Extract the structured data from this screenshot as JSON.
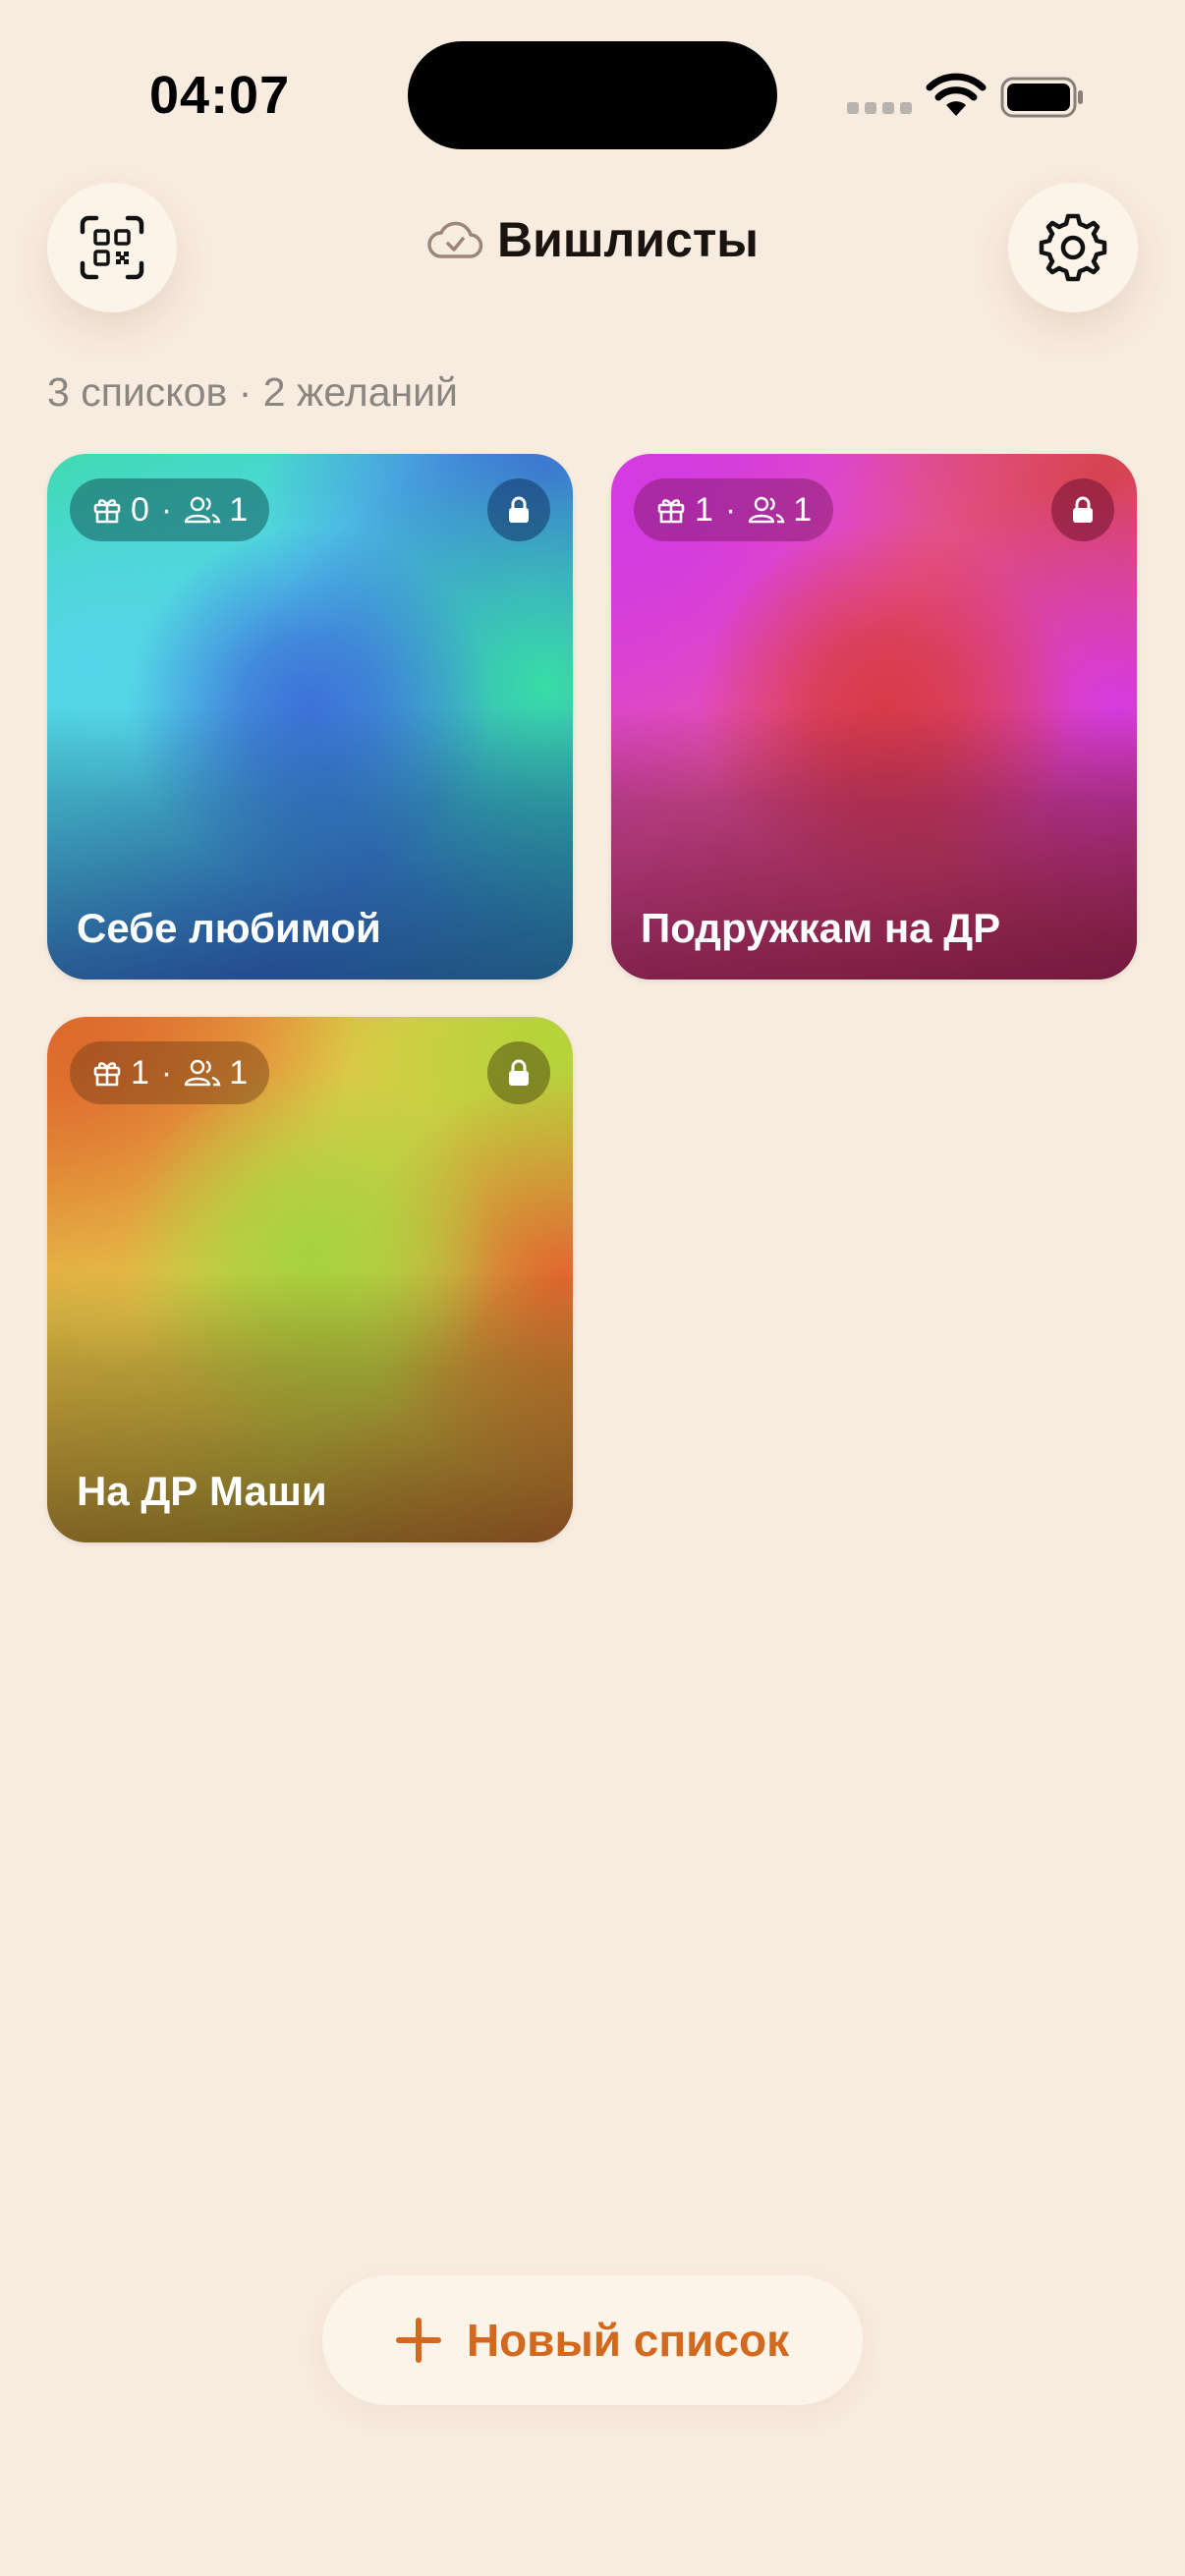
{
  "status_bar": {
    "time": "04:07"
  },
  "header": {
    "title": "Вишлисты",
    "sync_icon": "cloud-check-icon"
  },
  "summary": "3 списков · 2 желаний",
  "lists": [
    {
      "title": "Себе любимой",
      "gifts": "0",
      "people": "1",
      "private": true,
      "colors": [
        "#38DBA0",
        "#52D6E7",
        "#3D72D8"
      ]
    },
    {
      "title": "Подружкам на ДР",
      "gifts": "1",
      "people": "1",
      "private": true,
      "colors": [
        "#D33BE0",
        "#EB57A6",
        "#D83A48"
      ]
    },
    {
      "title": "На ДР Маши",
      "gifts": "1",
      "people": "1",
      "private": true,
      "colors": [
        "#E07A33",
        "#E9C94C",
        "#A6D23E"
      ]
    }
  ],
  "new_list_button": {
    "label": "Новый список"
  },
  "accent_color": "#D2691E"
}
